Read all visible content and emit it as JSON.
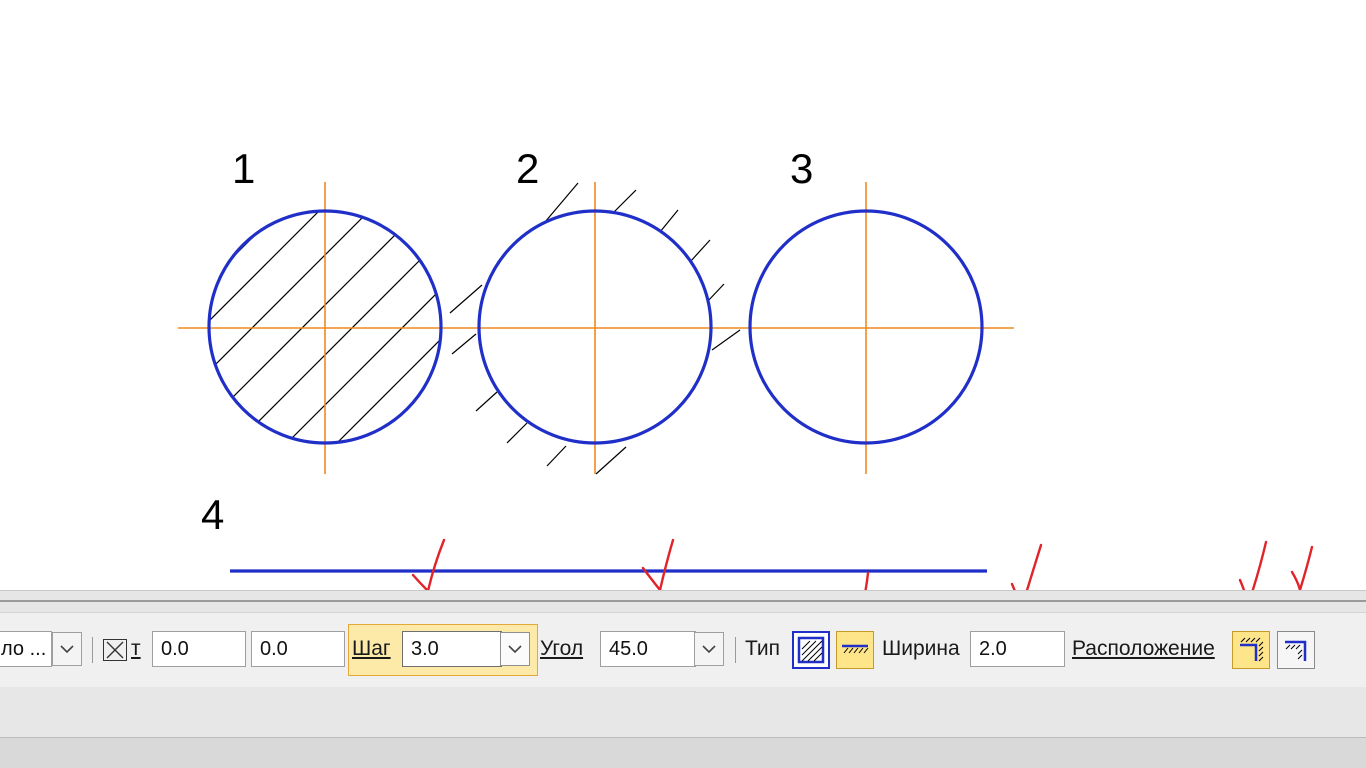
{
  "drawing": {
    "labels": [
      "1",
      "2",
      "3",
      "4"
    ],
    "colors": {
      "outline": "#1f2fc8",
      "centerline": "#f08a1e",
      "hatch": "#000000",
      "annotation": "#e0242a"
    }
  },
  "toolbar": {
    "dropdown_value": "ло ...",
    "close_icon": "x-box-icon",
    "t_label": "т",
    "x_value": "0.0",
    "y_value": "0.0",
    "step_label": "Шаг",
    "step_value": "3.0",
    "angle_label": "Угол",
    "angle_value": "45.0",
    "type_label": "Тип",
    "width_label": "Ширина",
    "width_value": "2.0",
    "position_label": "Расположение",
    "type_icons": [
      "hatch-fill-icon",
      "hatch-band-icon"
    ],
    "position_icons": [
      "hatch-outside-icon",
      "hatch-inside-icon"
    ]
  }
}
